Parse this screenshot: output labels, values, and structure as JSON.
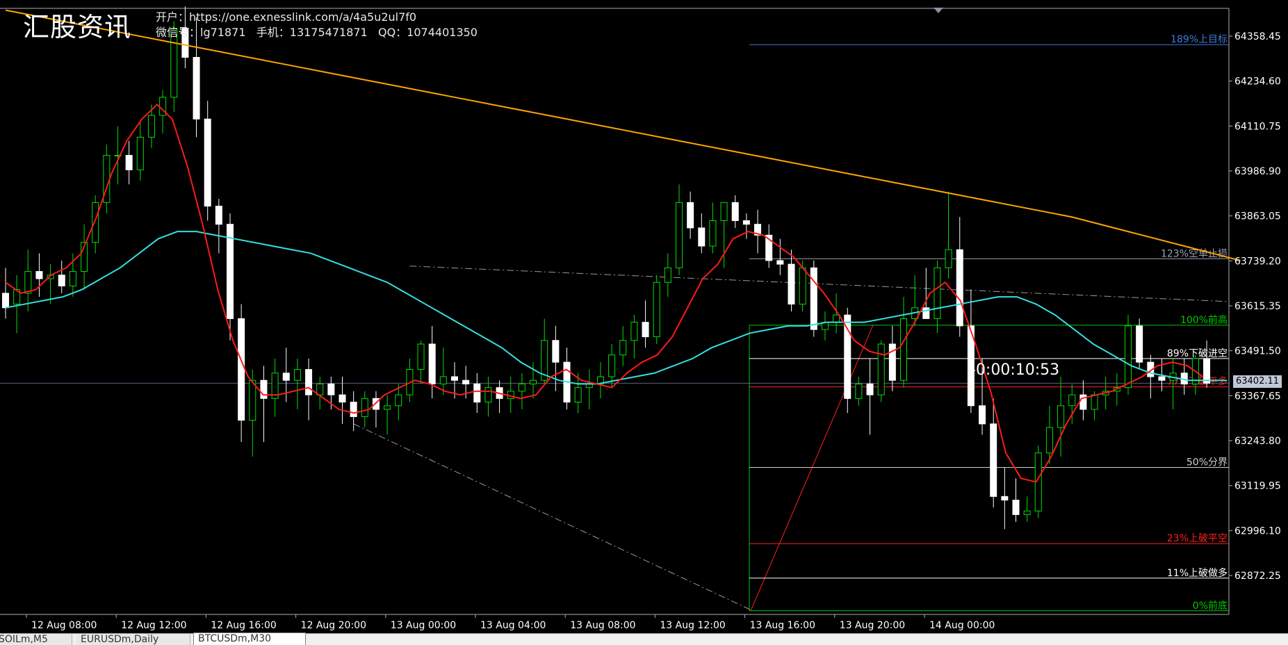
{
  "watermark": {
    "logo": "汇股资讯",
    "line1": "开户：https://one.exnesslink.com/a/4a5u2ul7f0",
    "line2": "微信号：lg71871   手机：13175471871   QQ：1074401350"
  },
  "countdown": "-0:00:10:53",
  "current_price_label": "63402.11",
  "tabs": [
    "SOILm,M5",
    "EURUSDm,Daily",
    "BTCUSDm,M30"
  ],
  "active_tab": 2,
  "colors": {
    "bull_candle": "#00e000",
    "bear_candle": "#ffffff",
    "ma_fast": "#ff1a1a",
    "ma_mid": "#33e0e0",
    "ma_slow": "#ffa500",
    "axis_text": "#ffffff"
  },
  "chart_data": {
    "type": "candlestick",
    "symbol": "BTCUSDm",
    "timeframe": "M30",
    "y_ticks": [
      64358.45,
      64234.6,
      64110.75,
      63986.9,
      63863.05,
      63739.2,
      63615.35,
      63491.5,
      63367.65,
      63243.8,
      63119.95,
      62996.1,
      62872.25
    ],
    "x_ticks": [
      "12 Aug 08:00",
      "12 Aug 12:00",
      "12 Aug 16:00",
      "12 Aug 20:00",
      "13 Aug 00:00",
      "13 Aug 04:00",
      "13 Aug 08:00",
      "13 Aug 12:00",
      "13 Aug 16:00",
      "13 Aug 20:00",
      "14 Aug 00:00"
    ],
    "ylim": [
      62765,
      64435
    ],
    "current_price": 63402.11,
    "candles": [
      {
        "o": 63650,
        "h": 63720,
        "l": 63580,
        "c": 63610
      },
      {
        "o": 63620,
        "h": 63700,
        "l": 63540,
        "c": 63660
      },
      {
        "o": 63650,
        "h": 63770,
        "l": 63600,
        "c": 63710
      },
      {
        "o": 63710,
        "h": 63760,
        "l": 63640,
        "c": 63690
      },
      {
        "o": 63690,
        "h": 63730,
        "l": 63620,
        "c": 63700
      },
      {
        "o": 63700,
        "h": 63740,
        "l": 63650,
        "c": 63670
      },
      {
        "o": 63670,
        "h": 63760,
        "l": 63640,
        "c": 63710
      },
      {
        "o": 63710,
        "h": 63840,
        "l": 63660,
        "c": 63790
      },
      {
        "o": 63790,
        "h": 63920,
        "l": 63760,
        "c": 63900
      },
      {
        "o": 63900,
        "h": 64060,
        "l": 63870,
        "c": 64030
      },
      {
        "o": 64030,
        "h": 64110,
        "l": 63950,
        "c": 64030
      },
      {
        "o": 64030,
        "h": 64070,
        "l": 63950,
        "c": 63990
      },
      {
        "o": 63990,
        "h": 64120,
        "l": 63960,
        "c": 64080
      },
      {
        "o": 64080,
        "h": 64170,
        "l": 64050,
        "c": 64140
      },
      {
        "o": 64140,
        "h": 64210,
        "l": 64090,
        "c": 64190
      },
      {
        "o": 64190,
        "h": 64400,
        "l": 64150,
        "c": 64380
      },
      {
        "o": 64380,
        "h": 64440,
        "l": 64270,
        "c": 64300
      },
      {
        "o": 64300,
        "h": 64410,
        "l": 64080,
        "c": 64130
      },
      {
        "o": 64130,
        "h": 64180,
        "l": 63850,
        "c": 63890
      },
      {
        "o": 63890,
        "h": 63910,
        "l": 63760,
        "c": 63840
      },
      {
        "o": 63840,
        "h": 63870,
        "l": 63520,
        "c": 63580
      },
      {
        "o": 63580,
        "h": 63620,
        "l": 63240,
        "c": 63300
      },
      {
        "o": 63300,
        "h": 63440,
        "l": 63200,
        "c": 63410
      },
      {
        "o": 63410,
        "h": 63450,
        "l": 63240,
        "c": 63360
      },
      {
        "o": 63360,
        "h": 63470,
        "l": 63310,
        "c": 63430
      },
      {
        "o": 63430,
        "h": 63500,
        "l": 63350,
        "c": 63410
      },
      {
        "o": 63410,
        "h": 63470,
        "l": 63330,
        "c": 63440
      },
      {
        "o": 63440,
        "h": 63470,
        "l": 63300,
        "c": 63370
      },
      {
        "o": 63370,
        "h": 63420,
        "l": 63330,
        "c": 63400
      },
      {
        "o": 63400,
        "h": 63420,
        "l": 63330,
        "c": 63370
      },
      {
        "o": 63370,
        "h": 63420,
        "l": 63290,
        "c": 63350
      },
      {
        "o": 63350,
        "h": 63380,
        "l": 63270,
        "c": 63310
      },
      {
        "o": 63310,
        "h": 63380,
        "l": 63280,
        "c": 63360
      },
      {
        "o": 63360,
        "h": 63380,
        "l": 63280,
        "c": 63330
      },
      {
        "o": 63330,
        "h": 63370,
        "l": 63260,
        "c": 63340
      },
      {
        "o": 63340,
        "h": 63400,
        "l": 63300,
        "c": 63370
      },
      {
        "o": 63370,
        "h": 63470,
        "l": 63350,
        "c": 63440
      },
      {
        "o": 63440,
        "h": 63520,
        "l": 63400,
        "c": 63510
      },
      {
        "o": 63510,
        "h": 63560,
        "l": 63360,
        "c": 63400
      },
      {
        "o": 63400,
        "h": 63500,
        "l": 63370,
        "c": 63420
      },
      {
        "o": 63420,
        "h": 63460,
        "l": 63360,
        "c": 63410
      },
      {
        "o": 63410,
        "h": 63450,
        "l": 63360,
        "c": 63400
      },
      {
        "o": 63400,
        "h": 63430,
        "l": 63320,
        "c": 63350
      },
      {
        "o": 63350,
        "h": 63420,
        "l": 63310,
        "c": 63390
      },
      {
        "o": 63390,
        "h": 63410,
        "l": 63320,
        "c": 63360
      },
      {
        "o": 63360,
        "h": 63420,
        "l": 63320,
        "c": 63380
      },
      {
        "o": 63380,
        "h": 63430,
        "l": 63330,
        "c": 63400
      },
      {
        "o": 63400,
        "h": 63460,
        "l": 63360,
        "c": 63410
      },
      {
        "o": 63410,
        "h": 63580,
        "l": 63400,
        "c": 63520
      },
      {
        "o": 63520,
        "h": 63560,
        "l": 63380,
        "c": 63460
      },
      {
        "o": 63460,
        "h": 63500,
        "l": 63330,
        "c": 63350
      },
      {
        "o": 63350,
        "h": 63430,
        "l": 63320,
        "c": 63390
      },
      {
        "o": 63390,
        "h": 63440,
        "l": 63330,
        "c": 63400
      },
      {
        "o": 63400,
        "h": 63460,
        "l": 63360,
        "c": 63420
      },
      {
        "o": 63420,
        "h": 63510,
        "l": 63390,
        "c": 63480
      },
      {
        "o": 63480,
        "h": 63560,
        "l": 63450,
        "c": 63520
      },
      {
        "o": 63520,
        "h": 63590,
        "l": 63470,
        "c": 63570
      },
      {
        "o": 63570,
        "h": 63630,
        "l": 63500,
        "c": 63530
      },
      {
        "o": 63530,
        "h": 63700,
        "l": 63510,
        "c": 63680
      },
      {
        "o": 63680,
        "h": 63760,
        "l": 63640,
        "c": 63720
      },
      {
        "o": 63720,
        "h": 63950,
        "l": 63700,
        "c": 63900
      },
      {
        "o": 63900,
        "h": 63930,
        "l": 63800,
        "c": 63830
      },
      {
        "o": 63830,
        "h": 63870,
        "l": 63760,
        "c": 63780
      },
      {
        "o": 63780,
        "h": 63900,
        "l": 63760,
        "c": 63850
      },
      {
        "o": 63850,
        "h": 63900,
        "l": 63720,
        "c": 63900
      },
      {
        "o": 63900,
        "h": 63920,
        "l": 63830,
        "c": 63850
      },
      {
        "o": 63850,
        "h": 63870,
        "l": 63800,
        "c": 63840
      },
      {
        "o": 63840,
        "h": 63880,
        "l": 63760,
        "c": 63810
      },
      {
        "o": 63810,
        "h": 63840,
        "l": 63720,
        "c": 63740
      },
      {
        "o": 63740,
        "h": 63800,
        "l": 63700,
        "c": 63730
      },
      {
        "o": 63730,
        "h": 63770,
        "l": 63600,
        "c": 63620
      },
      {
        "o": 63620,
        "h": 63740,
        "l": 63600,
        "c": 63720
      },
      {
        "o": 63720,
        "h": 63740,
        "l": 63530,
        "c": 63550
      },
      {
        "o": 63550,
        "h": 63600,
        "l": 63520,
        "c": 63570
      },
      {
        "o": 63570,
        "h": 63650,
        "l": 63540,
        "c": 63590
      },
      {
        "o": 63590,
        "h": 63610,
        "l": 63320,
        "c": 63360
      },
      {
        "o": 63360,
        "h": 63420,
        "l": 63340,
        "c": 63400
      },
      {
        "o": 63400,
        "h": 63470,
        "l": 63260,
        "c": 63370
      },
      {
        "o": 63370,
        "h": 63520,
        "l": 63350,
        "c": 63510
      },
      {
        "o": 63510,
        "h": 63560,
        "l": 63380,
        "c": 63410
      },
      {
        "o": 63410,
        "h": 63640,
        "l": 63390,
        "c": 63580
      },
      {
        "o": 63580,
        "h": 63700,
        "l": 63560,
        "c": 63610
      },
      {
        "o": 63610,
        "h": 63720,
        "l": 63580,
        "c": 63580
      },
      {
        "o": 63580,
        "h": 63740,
        "l": 63540,
        "c": 63720
      },
      {
        "o": 63720,
        "h": 63930,
        "l": 63690,
        "c": 63770
      },
      {
        "o": 63770,
        "h": 63860,
        "l": 63530,
        "c": 63560
      },
      {
        "o": 63560,
        "h": 63660,
        "l": 63320,
        "c": 63340
      },
      {
        "o": 63340,
        "h": 63470,
        "l": 63260,
        "c": 63290
      },
      {
        "o": 63290,
        "h": 63360,
        "l": 63060,
        "c": 63090
      },
      {
        "o": 63090,
        "h": 63170,
        "l": 63000,
        "c": 63080
      },
      {
        "o": 63080,
        "h": 63140,
        "l": 63020,
        "c": 63040
      },
      {
        "o": 63040,
        "h": 63090,
        "l": 63020,
        "c": 63050
      },
      {
        "o": 63050,
        "h": 63230,
        "l": 63030,
        "c": 63210
      },
      {
        "o": 63210,
        "h": 63340,
        "l": 63180,
        "c": 63280
      },
      {
        "o": 63280,
        "h": 63420,
        "l": 63200,
        "c": 63340
      },
      {
        "o": 63340,
        "h": 63400,
        "l": 63290,
        "c": 63370
      },
      {
        "o": 63370,
        "h": 63410,
        "l": 63300,
        "c": 63330
      },
      {
        "o": 63330,
        "h": 63380,
        "l": 63300,
        "c": 63370
      },
      {
        "o": 63370,
        "h": 63420,
        "l": 63330,
        "c": 63380
      },
      {
        "o": 63380,
        "h": 63430,
        "l": 63340,
        "c": 63390
      },
      {
        "o": 63390,
        "h": 63590,
        "l": 63370,
        "c": 63560
      },
      {
        "o": 63560,
        "h": 63580,
        "l": 63440,
        "c": 63460
      },
      {
        "o": 63460,
        "h": 63480,
        "l": 63360,
        "c": 63420
      },
      {
        "o": 63420,
        "h": 63470,
        "l": 63380,
        "c": 63410
      },
      {
        "o": 63410,
        "h": 63470,
        "l": 63330,
        "c": 63430
      },
      {
        "o": 63430,
        "h": 63470,
        "l": 63370,
        "c": 63400
      },
      {
        "o": 63400,
        "h": 63480,
        "l": 63370,
        "c": 63470
      },
      {
        "o": 63470,
        "h": 63520,
        "l": 63390,
        "c": 63402
      }
    ],
    "ma_fast": [
      63680,
      63650,
      63660,
      63700,
      63720,
      63760,
      63860,
      63980,
      64070,
      64130,
      64170,
      64130,
      64000,
      63840,
      63660,
      63520,
      63420,
      63370,
      63370,
      63380,
      63390,
      63360,
      63330,
      63320,
      63330,
      63370,
      63390,
      63410,
      63400,
      63380,
      63370,
      63380,
      63380,
      63370,
      63360,
      63370,
      63420,
      63440,
      63410,
      63400,
      63390,
      63430,
      63460,
      63480,
      63530,
      63610,
      63690,
      63730,
      63800,
      63820,
      63810,
      63780,
      63750,
      63700,
      63650,
      63590,
      63520,
      63490,
      63480,
      63500,
      63570,
      63650,
      63680,
      63630,
      63510,
      63380,
      63210,
      63140,
      63130,
      63200,
      63290,
      63360,
      63370,
      63380,
      63400,
      63420,
      63450,
      63460,
      63450,
      63420
    ],
    "ma_fast_start": 0,
    "ma_mid": [
      63610,
      63620,
      63630,
      63640,
      63660,
      63690,
      63720,
      63760,
      63800,
      63820,
      63820,
      63810,
      63800,
      63790,
      63780,
      63770,
      63760,
      63740,
      63720,
      63700,
      63680,
      63650,
      63620,
      63590,
      63560,
      63530,
      63500,
      63460,
      63430,
      63410,
      63400,
      63400,
      63410,
      63420,
      63430,
      63450,
      63470,
      63500,
      63520,
      63540,
      63550,
      63560,
      63560,
      63570,
      63570,
      63570,
      63580,
      63590,
      63600,
      63610,
      63620,
      63630,
      63640,
      63640,
      63620,
      63590,
      63550,
      63510,
      63480,
      63450,
      63430,
      63420,
      63410,
      63410,
      63410
    ],
    "ma_slow": [
      64430,
      64400,
      64370,
      64340,
      64310,
      64280,
      64250,
      64220,
      64190,
      64160,
      64130,
      64100,
      64070,
      64040,
      64010,
      63980,
      63950,
      63920,
      63890,
      63860,
      63820,
      63780,
      63740
    ],
    "fib_levels": [
      {
        "label": "189%上目标",
        "price": 64335,
        "color": "#3b7ddd"
      },
      {
        "label": "123%空单止损",
        "price": 63745,
        "color": "#9aa3b5"
      },
      {
        "label": "100%前高",
        "price": 63562,
        "color": "#00cc00"
      },
      {
        "label": "89%下破进空",
        "price": 63470,
        "color": "#ffffff"
      },
      {
        "label": "77%下破平多",
        "price": 63392,
        "color": "#ff2020"
      },
      {
        "label": "50%分界",
        "price": 63170,
        "color": "#cccccc"
      },
      {
        "label": "23%上破平空",
        "price": 62960,
        "color": "#ff2020"
      },
      {
        "label": "11%上破做多",
        "price": 62865,
        "color": "#ffffff"
      },
      {
        "label": "0%前底",
        "price": 62775,
        "color": "#00cc00"
      }
    ]
  }
}
